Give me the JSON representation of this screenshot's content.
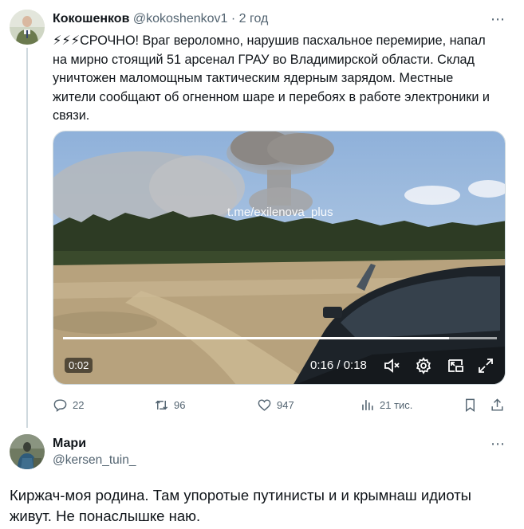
{
  "tweet": {
    "author_name": "Кокошенков",
    "author_handle": "@kokoshenkov1",
    "separator": " · ",
    "time_ago": "2 год",
    "text": "⚡⚡⚡СРОЧНО! Враг вероломно, нарушив пасхальное перемирие, напал на мирно стоящий 51 арсенал ГРАУ во Владимирской области. Склад уничтожен маломощным тактическим ядерным зарядом. Местные жители сообщают об огненном шаре и перебоях в работе электроники и связи.",
    "video": {
      "watermark": "t.me/exilenova_plus",
      "elapsed_badge": "0:02",
      "time_display": "0:16 / 0:18",
      "progress_fraction": 0.89
    },
    "actions": {
      "replies": "22",
      "reposts": "96",
      "likes": "947",
      "views": "21 тис."
    }
  },
  "reply": {
    "author_name": "Мари",
    "author_handle": "@kersen_tuin_",
    "text": "Киржач-моя родина. Там упоротые путинисты и и крымнаш идиоты живут. Не понаслышке наю."
  },
  "colors": {
    "text_primary": "#0f1419",
    "text_secondary": "#536471",
    "thread_line": "#cfd9de"
  },
  "icons": [
    "more-icon",
    "reply-icon",
    "repost-icon",
    "like-icon",
    "views-icon",
    "bookmark-icon",
    "share-icon",
    "mute-icon",
    "settings-icon",
    "pip-icon",
    "fullscreen-icon"
  ]
}
